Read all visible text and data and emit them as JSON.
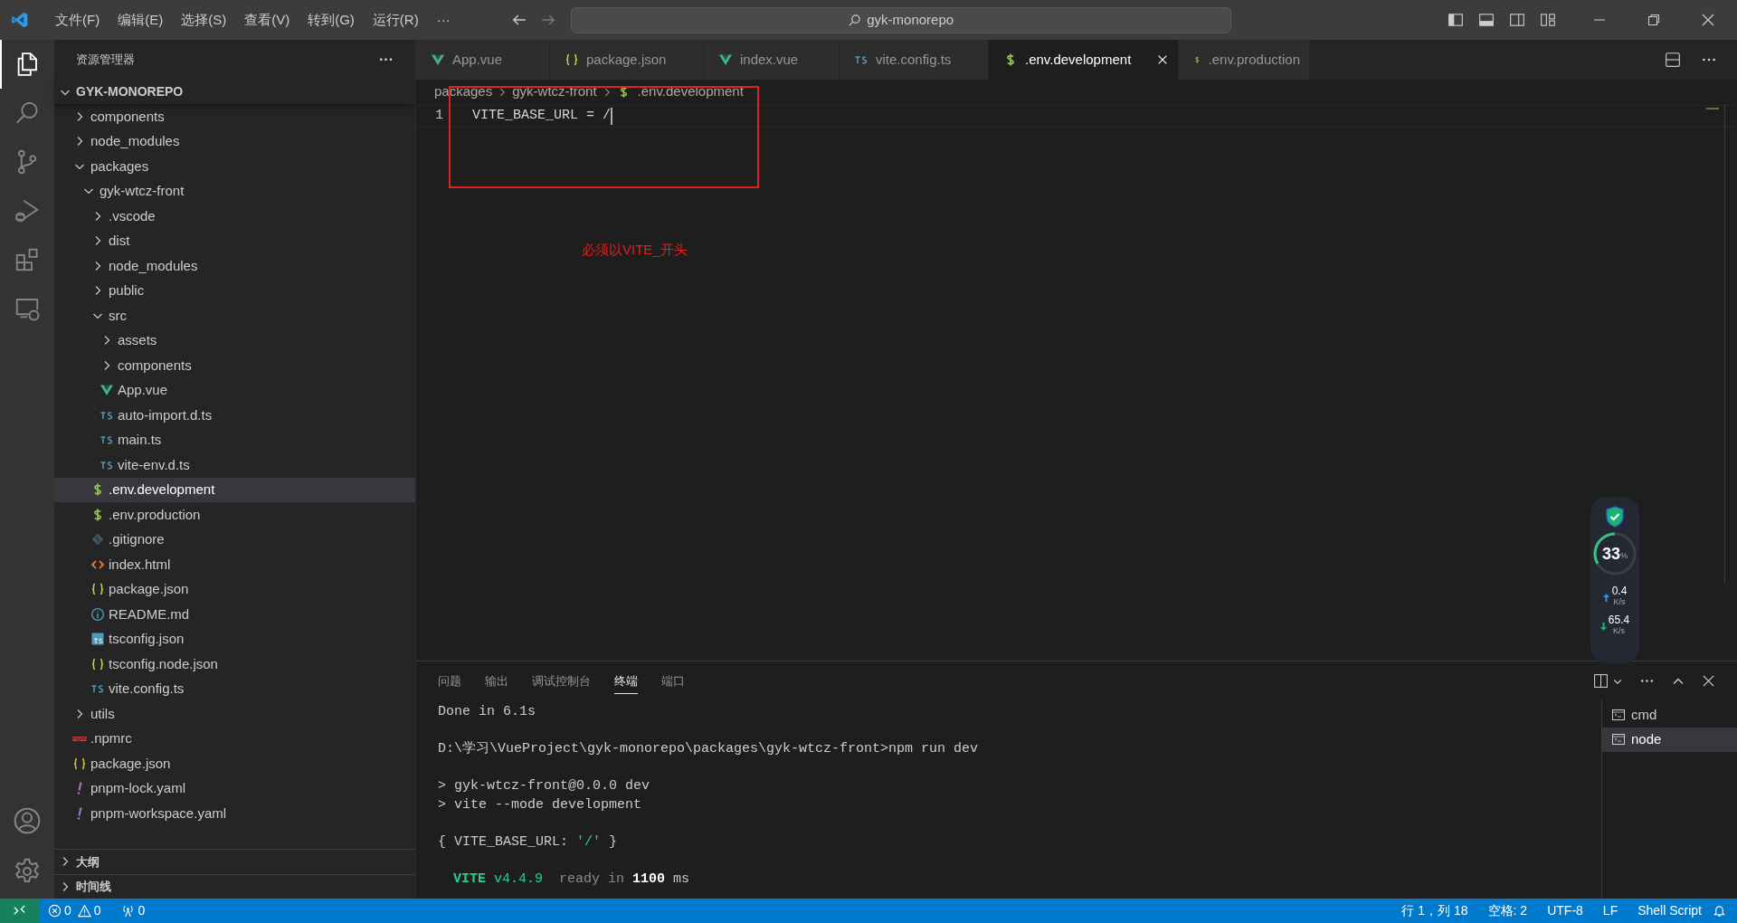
{
  "menu": [
    "文件(F)",
    "编辑(E)",
    "选择(S)",
    "查看(V)",
    "转到(G)",
    "运行(R)",
    "···"
  ],
  "search": {
    "value": "gyk-monorepo"
  },
  "sidebar": {
    "title": "资源管理器",
    "more": "···",
    "root": "GYK-MONOREPO",
    "tree": [
      {
        "name": "components",
        "kind": "folder",
        "expanded": false,
        "selected": false
      },
      {
        "name": "node_modules",
        "kind": "folder",
        "expanded": false,
        "selected": false
      },
      {
        "name": "packages",
        "kind": "folder",
        "expanded": true,
        "selected": false,
        "children": [
          {
            "name": "gyk-wtcz-front",
            "kind": "folder",
            "expanded": true,
            "selected": false,
            "children": [
              {
                "name": ".vscode",
                "kind": "folder",
                "expanded": false,
                "selected": false
              },
              {
                "name": "dist",
                "kind": "folder",
                "expanded": false,
                "selected": false
              },
              {
                "name": "node_modules",
                "kind": "folder",
                "expanded": false,
                "selected": false
              },
              {
                "name": "public",
                "kind": "folder",
                "expanded": false,
                "selected": false
              },
              {
                "name": "src",
                "kind": "folder",
                "expanded": true,
                "selected": false,
                "children": [
                  {
                    "name": "assets",
                    "kind": "folder",
                    "expanded": false,
                    "selected": false
                  },
                  {
                    "name": "components",
                    "kind": "folder",
                    "expanded": false,
                    "selected": false
                  },
                  {
                    "name": "App.vue",
                    "kind": "vue",
                    "selected": false
                  },
                  {
                    "name": "auto-import.d.ts",
                    "kind": "ts",
                    "selected": false
                  },
                  {
                    "name": "main.ts",
                    "kind": "ts",
                    "selected": false
                  },
                  {
                    "name": "vite-env.d.ts",
                    "kind": "ts",
                    "selected": false
                  }
                ]
              },
              {
                "name": ".env.development",
                "kind": "env",
                "selected": true
              },
              {
                "name": ".env.production",
                "kind": "env",
                "selected": false
              },
              {
                "name": ".gitignore",
                "kind": "git",
                "selected": false
              },
              {
                "name": "index.html",
                "kind": "html",
                "selected": false
              },
              {
                "name": "package.json",
                "kind": "json",
                "selected": false
              },
              {
                "name": "README.md",
                "kind": "info",
                "selected": false
              },
              {
                "name": "tsconfig.json",
                "kind": "tsconfig",
                "selected": false
              },
              {
                "name": "tsconfig.node.json",
                "kind": "json",
                "selected": false
              },
              {
                "name": "vite.config.ts",
                "kind": "ts",
                "selected": false
              }
            ]
          }
        ]
      },
      {
        "name": "utils",
        "kind": "folder",
        "expanded": false,
        "selected": false
      },
      {
        "name": ".npmrc",
        "kind": "npm",
        "selected": false
      },
      {
        "name": "package.json",
        "kind": "json",
        "selected": false
      },
      {
        "name": "pnpm-lock.yaml",
        "kind": "yaml",
        "selected": false
      },
      {
        "name": "pnpm-workspace.yaml",
        "kind": "yaml",
        "selected": false
      }
    ],
    "sections": [
      {
        "title": "大纲",
        "expanded": false
      },
      {
        "title": "时间线",
        "expanded": false
      }
    ]
  },
  "tabs": [
    {
      "label": "App.vue",
      "kind": "vue",
      "selected": false
    },
    {
      "label": "package.json",
      "kind": "json",
      "selected": false
    },
    {
      "label": "index.vue",
      "kind": "vue",
      "selected": false
    },
    {
      "label": "vite.config.ts",
      "kind": "ts",
      "selected": false
    },
    {
      "label": ".env.development",
      "kind": "env",
      "selected": true
    },
    {
      "label": ".env.production",
      "kind": "env",
      "selected": false
    }
  ],
  "breadcrumbs": [
    {
      "label": "packages",
      "kind": "folder"
    },
    {
      "label": "gyk-wtcz-front",
      "kind": "folder"
    },
    {
      "label": ".env.development",
      "kind": "env"
    }
  ],
  "editor": {
    "lines": [
      {
        "number": "1",
        "code": "VITE_BASE_URL = /"
      }
    ],
    "annotation": "必须以VITE_开头"
  },
  "panel": {
    "tabs": [
      {
        "label": "问题",
        "selected": false
      },
      {
        "label": "输出",
        "selected": false
      },
      {
        "label": "调试控制台",
        "selected": false
      },
      {
        "label": "终端",
        "selected": true
      },
      {
        "label": "端口",
        "selected": false
      }
    ],
    "terminal": [
      {
        "blank_before": false,
        "segments": [
          {
            "text": "Done in 6.1s",
            "kind": "plain"
          }
        ]
      },
      {
        "blank_before": true,
        "segments": [
          {
            "text": "D:\\学习\\VueProject\\gyk-monorepo\\packages\\gyk-wtcz-front>npm run dev",
            "kind": "plain"
          }
        ]
      },
      {
        "blank_before": true,
        "segments": [
          {
            "text": "> gyk-wtcz-front@0.0.0 dev",
            "kind": "plain"
          }
        ]
      },
      {
        "blank_before": false,
        "segments": [
          {
            "text": "> vite --mode development",
            "kind": "plain"
          }
        ]
      },
      {
        "blank_before": true,
        "segments": [
          {
            "text": "{ VITE_BASE_URL: ",
            "kind": "plain"
          },
          {
            "text": "'/'",
            "kind": "string"
          },
          {
            "text": " }",
            "kind": "plain"
          }
        ]
      },
      {
        "blank_before": true,
        "segments": [
          {
            "text": "VITE",
            "kind": "brand"
          },
          {
            "text": " v4.4.9",
            "kind": "version"
          },
          {
            "text": "  ready in ",
            "kind": "dim"
          },
          {
            "text": "1100",
            "kind": "bold"
          },
          {
            "text": " ms",
            "kind": "plain"
          }
        ]
      }
    ],
    "terminals": [
      {
        "label": "cmd",
        "selected": false
      },
      {
        "label": "node",
        "selected": true
      }
    ]
  },
  "widget": {
    "percent": "33",
    "unit": "%",
    "level": 0.33,
    "upload": "0.4",
    "upload_unit": "K/s",
    "download": "65.4",
    "download_unit": "K/s"
  },
  "status_bar": {
    "errors": "0",
    "warnings": "0",
    "ports": "0",
    "right": [
      "行 1，列 18",
      "空格: 2",
      "UTF-8",
      "LF",
      "Shell Script"
    ]
  }
}
